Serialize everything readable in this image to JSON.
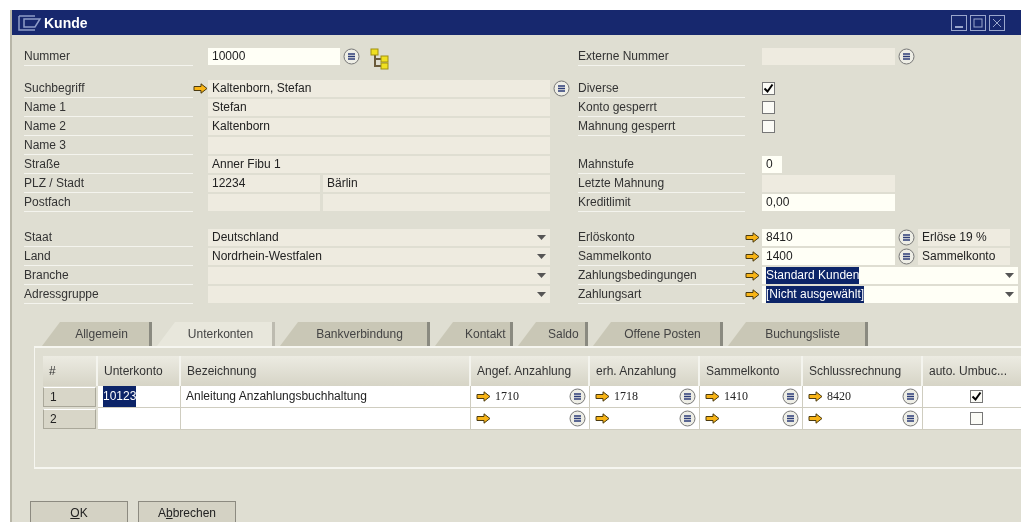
{
  "window": {
    "title": "Kunde"
  },
  "left_groups": [
    [
      {
        "kind": "code",
        "label": "Nummer",
        "value": "10000",
        "editable": true,
        "arrow": false,
        "list_button": true
      }
    ],
    [
      {
        "kind": "text",
        "label": "Suchbegriff",
        "value": "Kaltenborn, Stefan",
        "editable": false,
        "arrow": true,
        "list_button": true
      },
      {
        "kind": "text",
        "label": "Name 1",
        "value": "Stefan",
        "editable": false,
        "arrow": false,
        "list_button": false
      },
      {
        "kind": "text",
        "label": "Name 2",
        "value": "Kaltenborn",
        "editable": false,
        "arrow": false,
        "list_button": false
      },
      {
        "kind": "text",
        "label": "Name 3",
        "editable": false,
        "arrow": false,
        "list_button": false
      },
      {
        "kind": "text",
        "label": "Straße",
        "value": "Anner Fibu 1",
        "editable": false,
        "arrow": false,
        "list_button": false
      },
      {
        "kind": "pair",
        "label": "PLZ / Stadt",
        "values": [
          "12234",
          "Bärlin"
        ],
        "arrow": false,
        "list_button": false
      },
      {
        "kind": "pair",
        "label": "Postfach",
        "arrow": false,
        "list_button": false
      }
    ],
    [
      {
        "kind": "dropdown",
        "label": "Staat",
        "value": "Deutschland",
        "editable": false,
        "arrow": false,
        "list_button": false,
        "highlighted": false
      },
      {
        "kind": "dropdown",
        "label": "Land",
        "value": "Nordrhein-Westfalen",
        "editable": false,
        "arrow": false,
        "list_button": false,
        "highlighted": false
      },
      {
        "kind": "dropdown",
        "label": "Branche",
        "editable": false,
        "arrow": false,
        "list_button": false,
        "highlighted": false
      },
      {
        "kind": "dropdown",
        "label": "Adressgruppe",
        "editable": false,
        "arrow": false,
        "list_button": false,
        "highlighted": false
      }
    ]
  ],
  "right_groups": [
    [
      {
        "kind": "code",
        "label": "Externe Nummer",
        "editable": false,
        "arrow": false,
        "list_button": true
      }
    ],
    [
      {
        "kind": "checkbox",
        "label": "Diverse",
        "checked": true,
        "arrow": false,
        "list_button": false
      },
      {
        "kind": "checkbox",
        "label": "Konto gesperrt",
        "checked": false,
        "arrow": false,
        "list_button": false
      },
      {
        "kind": "checkbox",
        "label": "Mahnung gesperrt",
        "checked": false,
        "arrow": false,
        "list_button": false
      }
    ],
    [
      {
        "kind": "small",
        "label": "Mahnstufe",
        "value": "0",
        "editable": true,
        "arrow": false,
        "list_button": false
      },
      {
        "kind": "text",
        "label": "Letzte Mahnung",
        "editable": false,
        "arrow": false,
        "list_button": false
      },
      {
        "kind": "text",
        "label": "Kreditlimit",
        "value": "0,00",
        "editable": true,
        "arrow": false,
        "list_button": false
      }
    ],
    [
      {
        "kind": "text",
        "label": "Erlöskonto",
        "value": "8410",
        "editable": true,
        "arrow": true,
        "list_button": true,
        "extra": "Erlöse 19 %"
      },
      {
        "kind": "text",
        "label": "Sammelkonto",
        "value": "1400",
        "editable": true,
        "arrow": true,
        "list_button": true,
        "extra": "Sammelkonto"
      },
      {
        "kind": "dropdown",
        "label": "Zahlungsbedingungen",
        "value": "Standard Kunden",
        "editable": true,
        "arrow": true,
        "list_button": false,
        "highlighted": true
      },
      {
        "kind": "dropdown",
        "label": "Zahlungsart",
        "value": "[Nicht ausgewählt]",
        "editable": true,
        "arrow": true,
        "list_button": false,
        "highlighted": true
      }
    ]
  ],
  "tabs": [
    {
      "label": "Allgemein",
      "selected": false
    },
    {
      "label": "Unterkonten",
      "selected": true
    },
    {
      "label": "Bankverbindung",
      "selected": false
    },
    {
      "label": "Kontakt",
      "selected": false
    },
    {
      "label": "Saldo",
      "selected": false
    },
    {
      "label": "Offene Posten",
      "selected": false
    },
    {
      "label": "Buchungsliste",
      "selected": false
    }
  ],
  "table": {
    "columns": [
      "#",
      "Unterkonto",
      "Bezeichnung",
      "Angef. Anzahlung",
      "erh. Anzahlung",
      "Sammelkonto",
      "Schlussrechnung",
      "auto. Umbuc..."
    ],
    "rows": [
      {
        "cells": [
          {
            "kind": "number",
            "value": "1"
          },
          {
            "kind": "text",
            "value": "10123",
            "highlighted": true
          },
          {
            "kind": "text",
            "value": "Anleitung Anzahlungsbuchhaltung",
            "highlighted": false
          },
          {
            "kind": "link",
            "value": "1710"
          },
          {
            "kind": "link",
            "value": "1718"
          },
          {
            "kind": "link",
            "value": "1410"
          },
          {
            "kind": "link",
            "value": "8420"
          },
          {
            "kind": "checkbox",
            "checked": true
          }
        ]
      },
      {
        "cells": [
          {
            "kind": "number",
            "value": "2"
          },
          {
            "kind": "text",
            "highlighted": false
          },
          {
            "kind": "text",
            "highlighted": false
          },
          {
            "kind": "link"
          },
          {
            "kind": "link"
          },
          {
            "kind": "link"
          },
          {
            "kind": "link"
          },
          {
            "kind": "checkbox",
            "checked": false
          }
        ]
      }
    ]
  },
  "buttons": [
    {
      "key": "O",
      "after": "K"
    },
    {
      "before": "A",
      "key": "b",
      "after": "brechen"
    }
  ]
}
